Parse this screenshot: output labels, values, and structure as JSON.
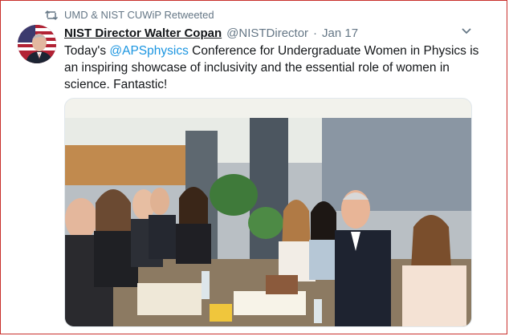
{
  "retweet": {
    "label": "UMD & NIST CUWiP Retweeted",
    "icon": "retweet-icon"
  },
  "tweet": {
    "display_name": "NIST Director Walter Copan",
    "handle": "@NISTDirector",
    "separator": "·",
    "date": "Jan 17",
    "text_before": "Today's ",
    "mention": "@APSphysics",
    "text_after": " Conference for Undergraduate Women in Physics is an inspiring showcase of inclusivity and the essential role of women in science. Fantastic!",
    "avatar_icon": "avatar-flag-portrait",
    "menu_icon": "chevron-down-icon"
  },
  "colors": {
    "text": "#14171a",
    "muted": "#657786",
    "link": "#1b95e0",
    "frame_border": "#c9302c"
  }
}
